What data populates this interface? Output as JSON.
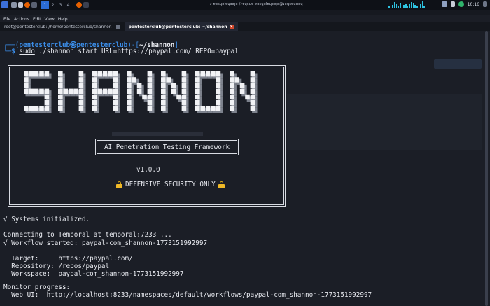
{
  "panel": {
    "workspaces": [
      "1",
      "2",
      "3",
      "4"
    ],
    "window_title": "ɾ ɐosɥǝlɐɥɔǝɟǝ /ɾɐɥsɥɐ ɐosɥǝlɐɥɔǝɟǝ@ɹǝɥsɐuuoɥ",
    "clock": "10:16"
  },
  "menu": [
    "File",
    "Actions",
    "Edit",
    "View",
    "Help"
  ],
  "tabs": [
    {
      "label": "root@pentesterclub: /home/pentesterclub/shannon"
    },
    {
      "label": "pentesterclub@pentesterclub: ~/shannon"
    }
  ],
  "prompt": {
    "open": "┌──(",
    "user_host": "pentesterclub㉿pentesterclub",
    "mid": ")-[",
    "path": "~/shannon",
    "close": "]",
    "lead": "└─",
    "symbol": "$",
    "sudo": "sudo",
    "command": " ./shannon start URL=https://paypal.com/ REPO=paypal"
  },
  "banner": {
    "logo": "SHANNON",
    "subtitle": "AI Penetration Testing Framework",
    "version": "v1.0.0",
    "notice": "DEFENSIVE SECURITY ONLY",
    "notice_icon": "lock-icon"
  },
  "output": {
    "init": "√ Systems initialized.",
    "connecting": "Connecting to Temporal at temporal:7233 ...",
    "workflow": "√ Workflow started: paypal-com_shannon-1773151992997",
    "target": "  Target:     https://paypal.com/",
    "repository": "  Repository: /repos/paypal",
    "workspace": "  Workspace:  paypal-com_shannon-1773151992997",
    "monitor": "Monitor progress:",
    "webui": "  Web UI:  http://localhost:8233/namespaces/default/workflows/paypal-com_shannon-1773151992997"
  },
  "colors": {
    "background": "#1b1e26",
    "prompt_blue": "#3b8eea",
    "text": "#e6e8ee",
    "accent": "#2b6cd4"
  }
}
